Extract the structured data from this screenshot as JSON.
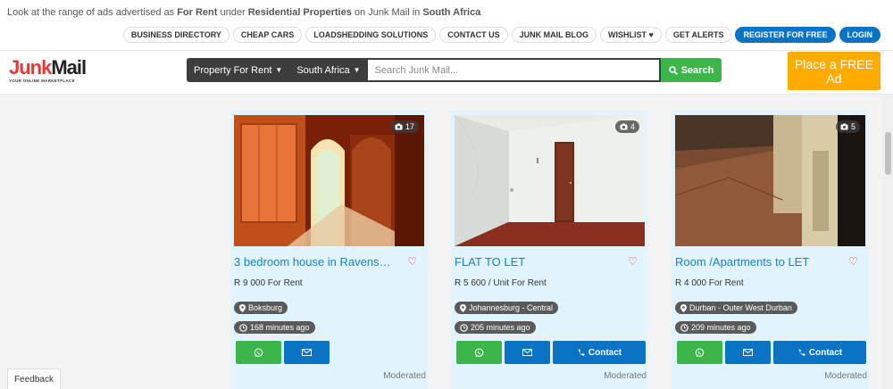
{
  "intro": {
    "prefix": "Look at the range of ads advertised as",
    "category": "For Rent",
    "mid1": "under",
    "section": "Residential Properties",
    "mid2": "on Junk Mail in",
    "region": "South Africa"
  },
  "toplinks": [
    "BUSINESS DIRECTORY",
    "CHEAP CARS",
    "LOADSHEDDING SOLUTIONS",
    "CONTACT US",
    "JUNK MAIL BLOG",
    "WISHLIST ♥",
    "GET ALERTS"
  ],
  "auth": {
    "register": "REGISTER FOR FREE",
    "login": "LOGIN"
  },
  "logo": {
    "junk": "Junk",
    "mail": "Mail",
    "tagline": "YOUR ONLINE MARKETPLACE"
  },
  "search": {
    "category": "Property For Rent",
    "region": "South Africa",
    "placeholder": "Search Junk Mail...",
    "button": "Search"
  },
  "place_ad": "Place a FREE Ad",
  "listings": [
    {
      "title": "3 bedroom house in Ravens…",
      "price": "R 9 000 For Rent",
      "location": "Boksburg",
      "time": "168 minutes ago",
      "photos": "17",
      "moderated": "Moderated"
    },
    {
      "title": "FLAT TO LET",
      "price": "R 5 600 / Unit For Rent",
      "location": "Johannesburg - Central",
      "time": "205 minutes ago",
      "photos": "4",
      "moderated": "Moderated",
      "contact": "Contact"
    },
    {
      "title": "Room /Apartments to LET",
      "price": "R 4 000 For Rent",
      "location": "Durban - Outer West Durban",
      "time": "209 minutes ago",
      "photos": "5",
      "moderated": "Moderated",
      "contact": "Contact"
    }
  ],
  "feedback": "Feedback",
  "colors": {
    "accent": "#0a73c4",
    "green": "#3cb54a",
    "orange": "#ffab00",
    "red": "#e53935"
  }
}
